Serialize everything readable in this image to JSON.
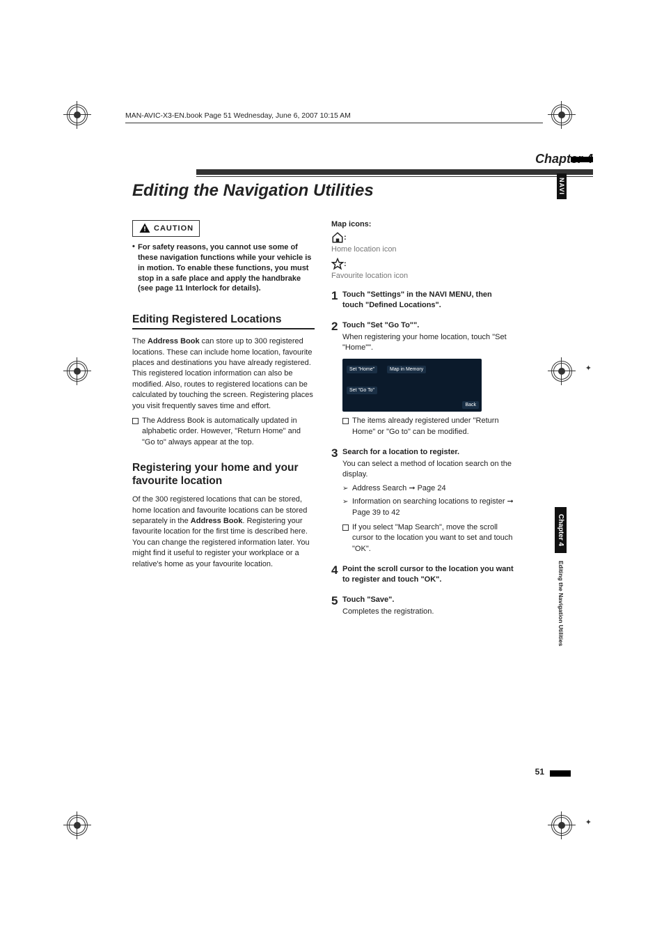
{
  "header": {
    "runhead": "MAN-AVIC-X3-EN.book  Page 51  Wednesday, June 6, 2007  10:15 AM"
  },
  "chapter": {
    "label": "Chapter 4",
    "title": "Editing the Navigation Utilities",
    "navi_tab": "NAVI",
    "side_tab": "Chapter 4",
    "side_text": "Editing the Navigation Utilities"
  },
  "caution": {
    "label": "CAUTION",
    "bullet": "For safety reasons, you cannot use some of these navigation functions while your vehicle is in motion. To enable these functions, you must stop in a safe place and apply the handbrake (see page 11 Interlock for details)."
  },
  "section1": {
    "head": "Editing Registered Locations",
    "para1_pre": "The ",
    "para1_b": "Address Book",
    "para1_post": " can store up to 300 registered locations. These can include home location, favourite places and destinations you have already registered. This registered location information can also be modified. Also, routes to registered locations can be calculated by touching the screen. Registering places you visit frequently saves time and effort.",
    "note1_pre": "The Address Book is automatically updated in alphabetic order. However, \"",
    "note1_b1": "Return Home",
    "note1_mid": "\" and \"",
    "note1_b2": "Go to",
    "note1_post": "\" always appear at the top."
  },
  "section2": {
    "head": "Registering your home and your favourite location",
    "para_pre": "Of the 300 registered locations that can be stored, home location and favourite locations can be stored separately in the ",
    "para_b": "Address Book",
    "para_post": ". Registering your favourite location for the first time is described here. You can change the registered information later. You might find it useful to register your workplace or a relative's home as your favourite location."
  },
  "right": {
    "mapicons_label": "Map icons:",
    "home_caption": "Home location icon",
    "fav_caption": "Favourite location icon",
    "steps": {
      "s1": {
        "num": "1",
        "title_pre": "Touch \"Settings\" in the ",
        "title_b": "NAVI MENU",
        "title_post": ", then touch \"Defined Locations\"."
      },
      "s2": {
        "num": "2",
        "title": "Touch \"Set \"Go To\"\".",
        "desc_pre": "When registering your home location, touch \"",
        "desc_b": "Set \"Home\"",
        "desc_post": "\"."
      },
      "screenshot": {
        "btn1": "Set \"Home\"",
        "btn2": "Map in Memory",
        "btn3": "Set \"Go To\"",
        "back": "Back"
      },
      "note2_pre": "The items already registered under \"",
      "note2_b1": "Return Home",
      "note2_mid": "\" or \"",
      "note2_b2": "Go to",
      "note2_post": "\" can be modified.",
      "s3": {
        "num": "3",
        "title": "Search for a location to register.",
        "desc": "You can select a method of location search on the display.",
        "sub1": "Address Search ➞ Page 24",
        "sub2": "Information on searching locations to register ➞ Page 39 to 42",
        "sub3_pre": "If you select \"",
        "sub3_b1": "Map Search",
        "sub3_mid": "\", move the scroll cursor to the location you want to set and touch \"",
        "sub3_b2": "OK",
        "sub3_post": "\"."
      },
      "s4": {
        "num": "4",
        "title": "Point the scroll cursor to the location you want to register and touch \"OK\"."
      },
      "s5": {
        "num": "5",
        "title": "Touch \"Save\".",
        "desc": "Completes the registration."
      }
    }
  },
  "page_number": "51"
}
